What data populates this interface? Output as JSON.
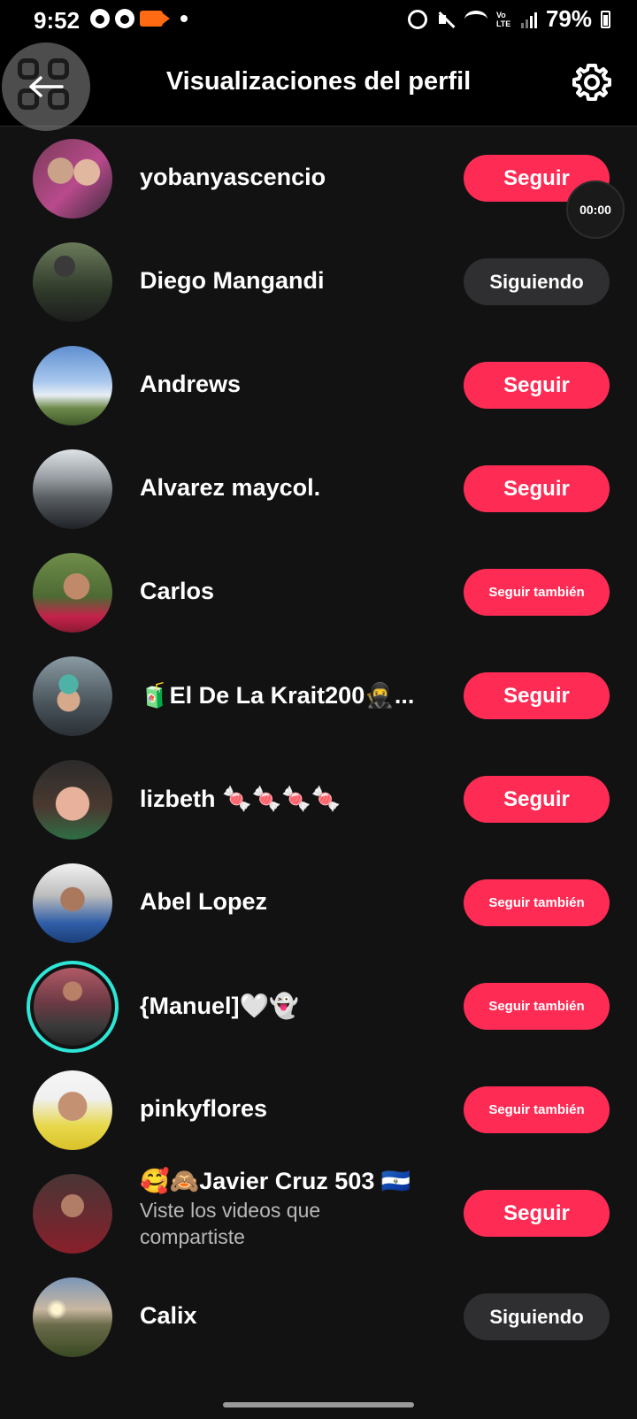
{
  "status_bar": {
    "time": "9:52",
    "battery": "79%"
  },
  "header": {
    "title": "Visualizaciones del perfil",
    "back_icon": "back-arrow-icon",
    "settings_icon": "gear-icon"
  },
  "overlay": {
    "timer": "00:00"
  },
  "colors": {
    "accent": "#fe2c55",
    "following_bg": "#2f2f31",
    "ring": "#2ee6d6"
  },
  "rows": [
    {
      "name": "yobanyascencio",
      "button": "Seguir"
    },
    {
      "name": "Diego Mangandi",
      "button": "Siguiendo"
    },
    {
      "name": "Andrews",
      "button": "Seguir"
    },
    {
      "name": "Alvarez maycol.",
      "button": "Seguir"
    },
    {
      "name": "Carlos",
      "button": "Seguir también"
    },
    {
      "name": "🧃El De La Krait200🥷...",
      "button": "Seguir"
    },
    {
      "name": "lizbeth 🍬🍬🍬🍬",
      "button": "Seguir"
    },
    {
      "name": "Abel Lopez",
      "button": "Seguir también"
    },
    {
      "name": "{Manuel]🤍👻",
      "button": "Seguir también"
    },
    {
      "name": "pinkyflores",
      "button": "Seguir también"
    },
    {
      "name": "🥰🙈Javier Cruz 503 🇸🇻",
      "subtitle": "Viste los videos que compartiste",
      "button": "Seguir"
    },
    {
      "name": "Calix",
      "button": "Siguiendo"
    }
  ]
}
